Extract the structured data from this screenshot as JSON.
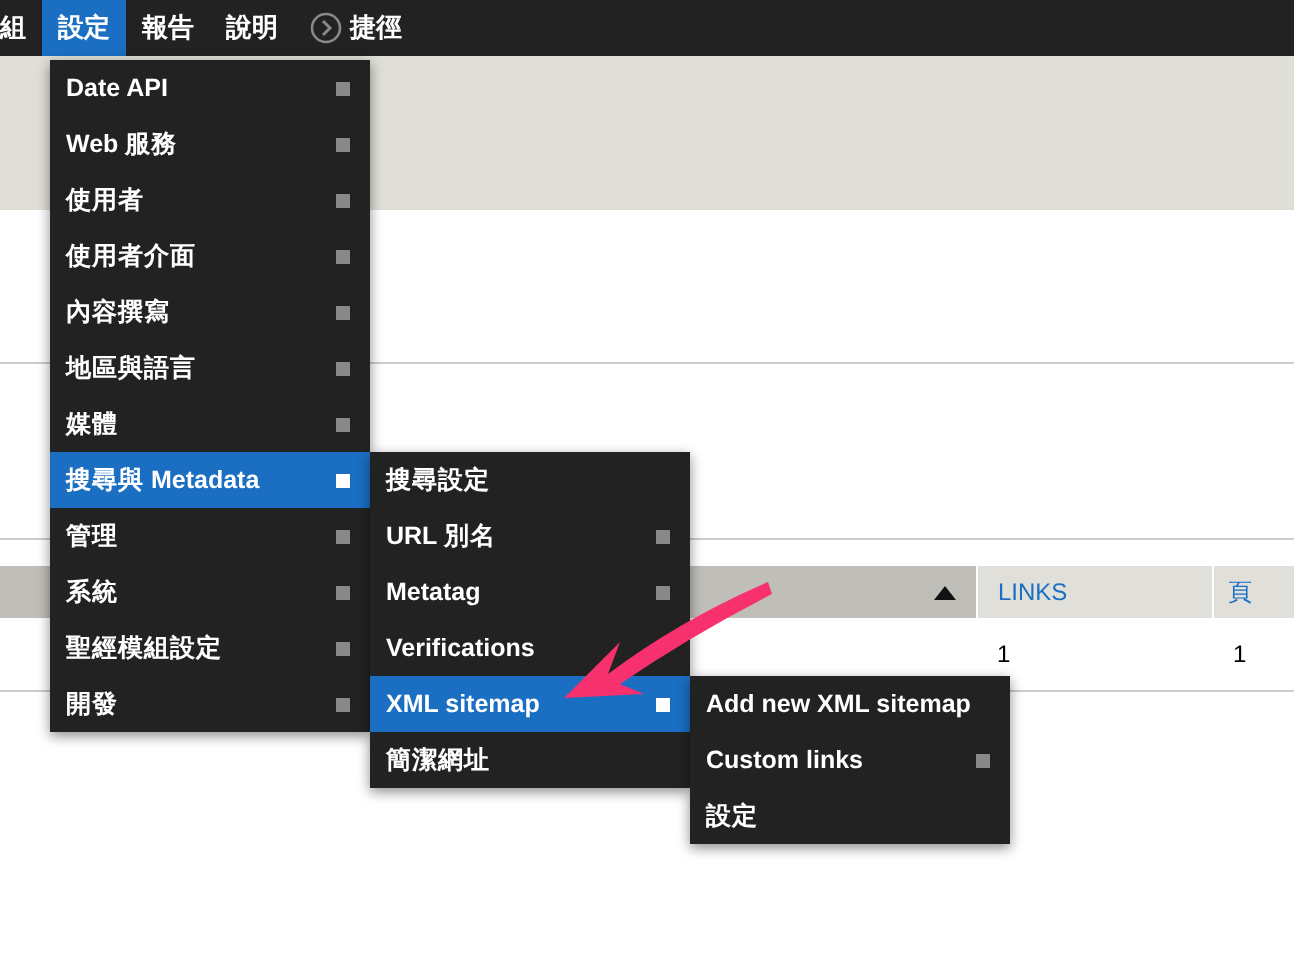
{
  "toolbar": {
    "items": [
      {
        "label": "組",
        "selected": false,
        "kind": "text"
      },
      {
        "label": "設定",
        "selected": true,
        "kind": "text"
      },
      {
        "label": "報告",
        "selected": false,
        "kind": "text"
      },
      {
        "label": "說明",
        "selected": false,
        "kind": "text"
      },
      {
        "label": "捷徑",
        "selected": false,
        "kind": "shortcut"
      }
    ]
  },
  "table": {
    "columns": [
      {
        "sorted": true
      },
      {
        "label": "LINKS",
        "sorted": false
      },
      {
        "label": "頁",
        "sorted": false
      }
    ],
    "rows": [
      [
        "",
        "1",
        "1"
      ]
    ]
  },
  "menu": {
    "items": [
      {
        "label": "Date API",
        "has_children": true,
        "selected": false
      },
      {
        "label": "Web 服務",
        "has_children": true,
        "selected": false
      },
      {
        "label": "使用者",
        "has_children": true,
        "selected": false
      },
      {
        "label": "使用者介面",
        "has_children": true,
        "selected": false
      },
      {
        "label": "內容撰寫",
        "has_children": true,
        "selected": false
      },
      {
        "label": "地區與語言",
        "has_children": true,
        "selected": false
      },
      {
        "label": "媒體",
        "has_children": true,
        "selected": false
      },
      {
        "label": "搜尋與 Metadata",
        "has_children": true,
        "selected": true,
        "children": [
          {
            "label": "搜尋設定",
            "has_children": false,
            "selected": false
          },
          {
            "label": "URL 別名",
            "has_children": true,
            "selected": false
          },
          {
            "label": "Metatag",
            "has_children": true,
            "selected": false
          },
          {
            "label": "Verifications",
            "has_children": false,
            "selected": false
          },
          {
            "label": "XML sitemap",
            "has_children": true,
            "selected": true,
            "children": [
              {
                "label": "Add new XML sitemap",
                "has_children": false,
                "selected": false
              },
              {
                "label": "Custom links",
                "has_children": true,
                "selected": false
              },
              {
                "label": "設定",
                "has_children": false,
                "selected": false
              }
            ]
          },
          {
            "label": "簡潔網址",
            "has_children": false,
            "selected": false
          }
        ]
      },
      {
        "label": "管理",
        "has_children": true,
        "selected": false
      },
      {
        "label": "系統",
        "has_children": true,
        "selected": false
      },
      {
        "label": "聖經模組設定",
        "has_children": true,
        "selected": false
      },
      {
        "label": "開發",
        "has_children": true,
        "selected": false
      }
    ]
  }
}
